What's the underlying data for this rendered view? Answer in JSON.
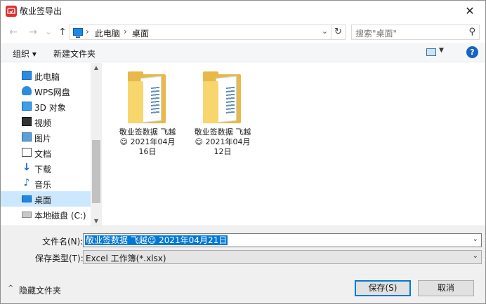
{
  "window": {
    "title": "敬业签导出"
  },
  "navbar": {
    "back": "←",
    "forward": "→",
    "recent": "⌄",
    "up": "↑",
    "breadcrumb": [
      "此电脑",
      "桌面"
    ],
    "search_placeholder": "搜索\"桌面\""
  },
  "toolbar": {
    "organize": "组织 ▾",
    "new_folder": "新建文件夹",
    "help": "?"
  },
  "sidebar": {
    "items": [
      {
        "label": "此电脑",
        "icon": "computer-icon"
      },
      {
        "label": "WPS网盘",
        "icon": "cloud-icon"
      },
      {
        "label": "3D 对象",
        "icon": "cube-icon"
      },
      {
        "label": "视频",
        "icon": "video-icon"
      },
      {
        "label": "图片",
        "icon": "picture-icon"
      },
      {
        "label": "文档",
        "icon": "document-icon"
      },
      {
        "label": "下载",
        "icon": "download-icon"
      },
      {
        "label": "音乐",
        "icon": "music-icon"
      },
      {
        "label": "桌面",
        "icon": "desktop-icon",
        "selected": true
      },
      {
        "label": "本地磁盘 (C:)",
        "icon": "drive-icon"
      }
    ]
  },
  "files": [
    {
      "line1": "敬业签数据 飞越",
      "line2": "☺ 2021年04月",
      "line3": "16日"
    },
    {
      "line1": "敬业签数据 飞越",
      "line2": "☺ 2021年04月",
      "line3": "12日"
    }
  ],
  "form": {
    "filename_label": "文件名(N):",
    "filename_value": "敬业签数据 飞越☺ 2021年04月21日",
    "filetype_label": "保存类型(T):",
    "filetype_value": "Excel 工作簿(*.xlsx)"
  },
  "footer": {
    "hide_folders": "隐藏文件夹",
    "save": "保存(S)",
    "cancel": "取消"
  }
}
